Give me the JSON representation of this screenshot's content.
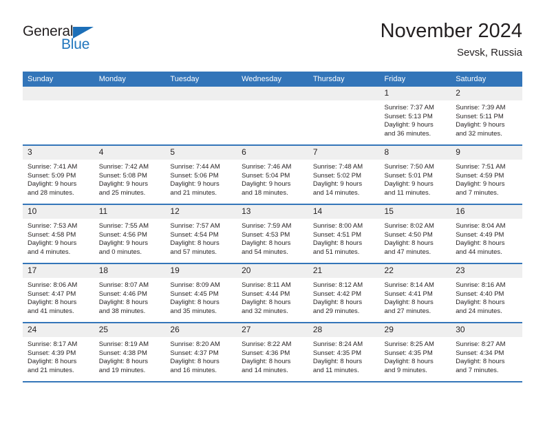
{
  "brand": {
    "name_part1": "General",
    "name_part2": "Blue",
    "triangle_icon": "triangle-icon",
    "accent_color": "#2176bd"
  },
  "header": {
    "title": "November 2024",
    "location": "Sevsk, Russia"
  },
  "calendar": {
    "header_bg": "#3375b9",
    "daynum_bg": "#efefef",
    "weekdays": [
      "Sunday",
      "Monday",
      "Tuesday",
      "Wednesday",
      "Thursday",
      "Friday",
      "Saturday"
    ],
    "weeks": [
      [
        {
          "day": "",
          "empty": true
        },
        {
          "day": "",
          "empty": true
        },
        {
          "day": "",
          "empty": true
        },
        {
          "day": "",
          "empty": true
        },
        {
          "day": "",
          "empty": true
        },
        {
          "day": "1",
          "sunrise": "Sunrise: 7:37 AM",
          "sunset": "Sunset: 5:13 PM",
          "daylight1": "Daylight: 9 hours",
          "daylight2": "and 36 minutes."
        },
        {
          "day": "2",
          "sunrise": "Sunrise: 7:39 AM",
          "sunset": "Sunset: 5:11 PM",
          "daylight1": "Daylight: 9 hours",
          "daylight2": "and 32 minutes."
        }
      ],
      [
        {
          "day": "3",
          "sunrise": "Sunrise: 7:41 AM",
          "sunset": "Sunset: 5:09 PM",
          "daylight1": "Daylight: 9 hours",
          "daylight2": "and 28 minutes."
        },
        {
          "day": "4",
          "sunrise": "Sunrise: 7:42 AM",
          "sunset": "Sunset: 5:08 PM",
          "daylight1": "Daylight: 9 hours",
          "daylight2": "and 25 minutes."
        },
        {
          "day": "5",
          "sunrise": "Sunrise: 7:44 AM",
          "sunset": "Sunset: 5:06 PM",
          "daylight1": "Daylight: 9 hours",
          "daylight2": "and 21 minutes."
        },
        {
          "day": "6",
          "sunrise": "Sunrise: 7:46 AM",
          "sunset": "Sunset: 5:04 PM",
          "daylight1": "Daylight: 9 hours",
          "daylight2": "and 18 minutes."
        },
        {
          "day": "7",
          "sunrise": "Sunrise: 7:48 AM",
          "sunset": "Sunset: 5:02 PM",
          "daylight1": "Daylight: 9 hours",
          "daylight2": "and 14 minutes."
        },
        {
          "day": "8",
          "sunrise": "Sunrise: 7:50 AM",
          "sunset": "Sunset: 5:01 PM",
          "daylight1": "Daylight: 9 hours",
          "daylight2": "and 11 minutes."
        },
        {
          "day": "9",
          "sunrise": "Sunrise: 7:51 AM",
          "sunset": "Sunset: 4:59 PM",
          "daylight1": "Daylight: 9 hours",
          "daylight2": "and 7 minutes."
        }
      ],
      [
        {
          "day": "10",
          "sunrise": "Sunrise: 7:53 AM",
          "sunset": "Sunset: 4:58 PM",
          "daylight1": "Daylight: 9 hours",
          "daylight2": "and 4 minutes."
        },
        {
          "day": "11",
          "sunrise": "Sunrise: 7:55 AM",
          "sunset": "Sunset: 4:56 PM",
          "daylight1": "Daylight: 9 hours",
          "daylight2": "and 0 minutes."
        },
        {
          "day": "12",
          "sunrise": "Sunrise: 7:57 AM",
          "sunset": "Sunset: 4:54 PM",
          "daylight1": "Daylight: 8 hours",
          "daylight2": "and 57 minutes."
        },
        {
          "day": "13",
          "sunrise": "Sunrise: 7:59 AM",
          "sunset": "Sunset: 4:53 PM",
          "daylight1": "Daylight: 8 hours",
          "daylight2": "and 54 minutes."
        },
        {
          "day": "14",
          "sunrise": "Sunrise: 8:00 AM",
          "sunset": "Sunset: 4:51 PM",
          "daylight1": "Daylight: 8 hours",
          "daylight2": "and 51 minutes."
        },
        {
          "day": "15",
          "sunrise": "Sunrise: 8:02 AM",
          "sunset": "Sunset: 4:50 PM",
          "daylight1": "Daylight: 8 hours",
          "daylight2": "and 47 minutes."
        },
        {
          "day": "16",
          "sunrise": "Sunrise: 8:04 AM",
          "sunset": "Sunset: 4:49 PM",
          "daylight1": "Daylight: 8 hours",
          "daylight2": "and 44 minutes."
        }
      ],
      [
        {
          "day": "17",
          "sunrise": "Sunrise: 8:06 AM",
          "sunset": "Sunset: 4:47 PM",
          "daylight1": "Daylight: 8 hours",
          "daylight2": "and 41 minutes."
        },
        {
          "day": "18",
          "sunrise": "Sunrise: 8:07 AM",
          "sunset": "Sunset: 4:46 PM",
          "daylight1": "Daylight: 8 hours",
          "daylight2": "and 38 minutes."
        },
        {
          "day": "19",
          "sunrise": "Sunrise: 8:09 AM",
          "sunset": "Sunset: 4:45 PM",
          "daylight1": "Daylight: 8 hours",
          "daylight2": "and 35 minutes."
        },
        {
          "day": "20",
          "sunrise": "Sunrise: 8:11 AM",
          "sunset": "Sunset: 4:44 PM",
          "daylight1": "Daylight: 8 hours",
          "daylight2": "and 32 minutes."
        },
        {
          "day": "21",
          "sunrise": "Sunrise: 8:12 AM",
          "sunset": "Sunset: 4:42 PM",
          "daylight1": "Daylight: 8 hours",
          "daylight2": "and 29 minutes."
        },
        {
          "day": "22",
          "sunrise": "Sunrise: 8:14 AM",
          "sunset": "Sunset: 4:41 PM",
          "daylight1": "Daylight: 8 hours",
          "daylight2": "and 27 minutes."
        },
        {
          "day": "23",
          "sunrise": "Sunrise: 8:16 AM",
          "sunset": "Sunset: 4:40 PM",
          "daylight1": "Daylight: 8 hours",
          "daylight2": "and 24 minutes."
        }
      ],
      [
        {
          "day": "24",
          "sunrise": "Sunrise: 8:17 AM",
          "sunset": "Sunset: 4:39 PM",
          "daylight1": "Daylight: 8 hours",
          "daylight2": "and 21 minutes."
        },
        {
          "day": "25",
          "sunrise": "Sunrise: 8:19 AM",
          "sunset": "Sunset: 4:38 PM",
          "daylight1": "Daylight: 8 hours",
          "daylight2": "and 19 minutes."
        },
        {
          "day": "26",
          "sunrise": "Sunrise: 8:20 AM",
          "sunset": "Sunset: 4:37 PM",
          "daylight1": "Daylight: 8 hours",
          "daylight2": "and 16 minutes."
        },
        {
          "day": "27",
          "sunrise": "Sunrise: 8:22 AM",
          "sunset": "Sunset: 4:36 PM",
          "daylight1": "Daylight: 8 hours",
          "daylight2": "and 14 minutes."
        },
        {
          "day": "28",
          "sunrise": "Sunrise: 8:24 AM",
          "sunset": "Sunset: 4:35 PM",
          "daylight1": "Daylight: 8 hours",
          "daylight2": "and 11 minutes."
        },
        {
          "day": "29",
          "sunrise": "Sunrise: 8:25 AM",
          "sunset": "Sunset: 4:35 PM",
          "daylight1": "Daylight: 8 hours",
          "daylight2": "and 9 minutes."
        },
        {
          "day": "30",
          "sunrise": "Sunrise: 8:27 AM",
          "sunset": "Sunset: 4:34 PM",
          "daylight1": "Daylight: 8 hours",
          "daylight2": "and 7 minutes."
        }
      ]
    ]
  }
}
